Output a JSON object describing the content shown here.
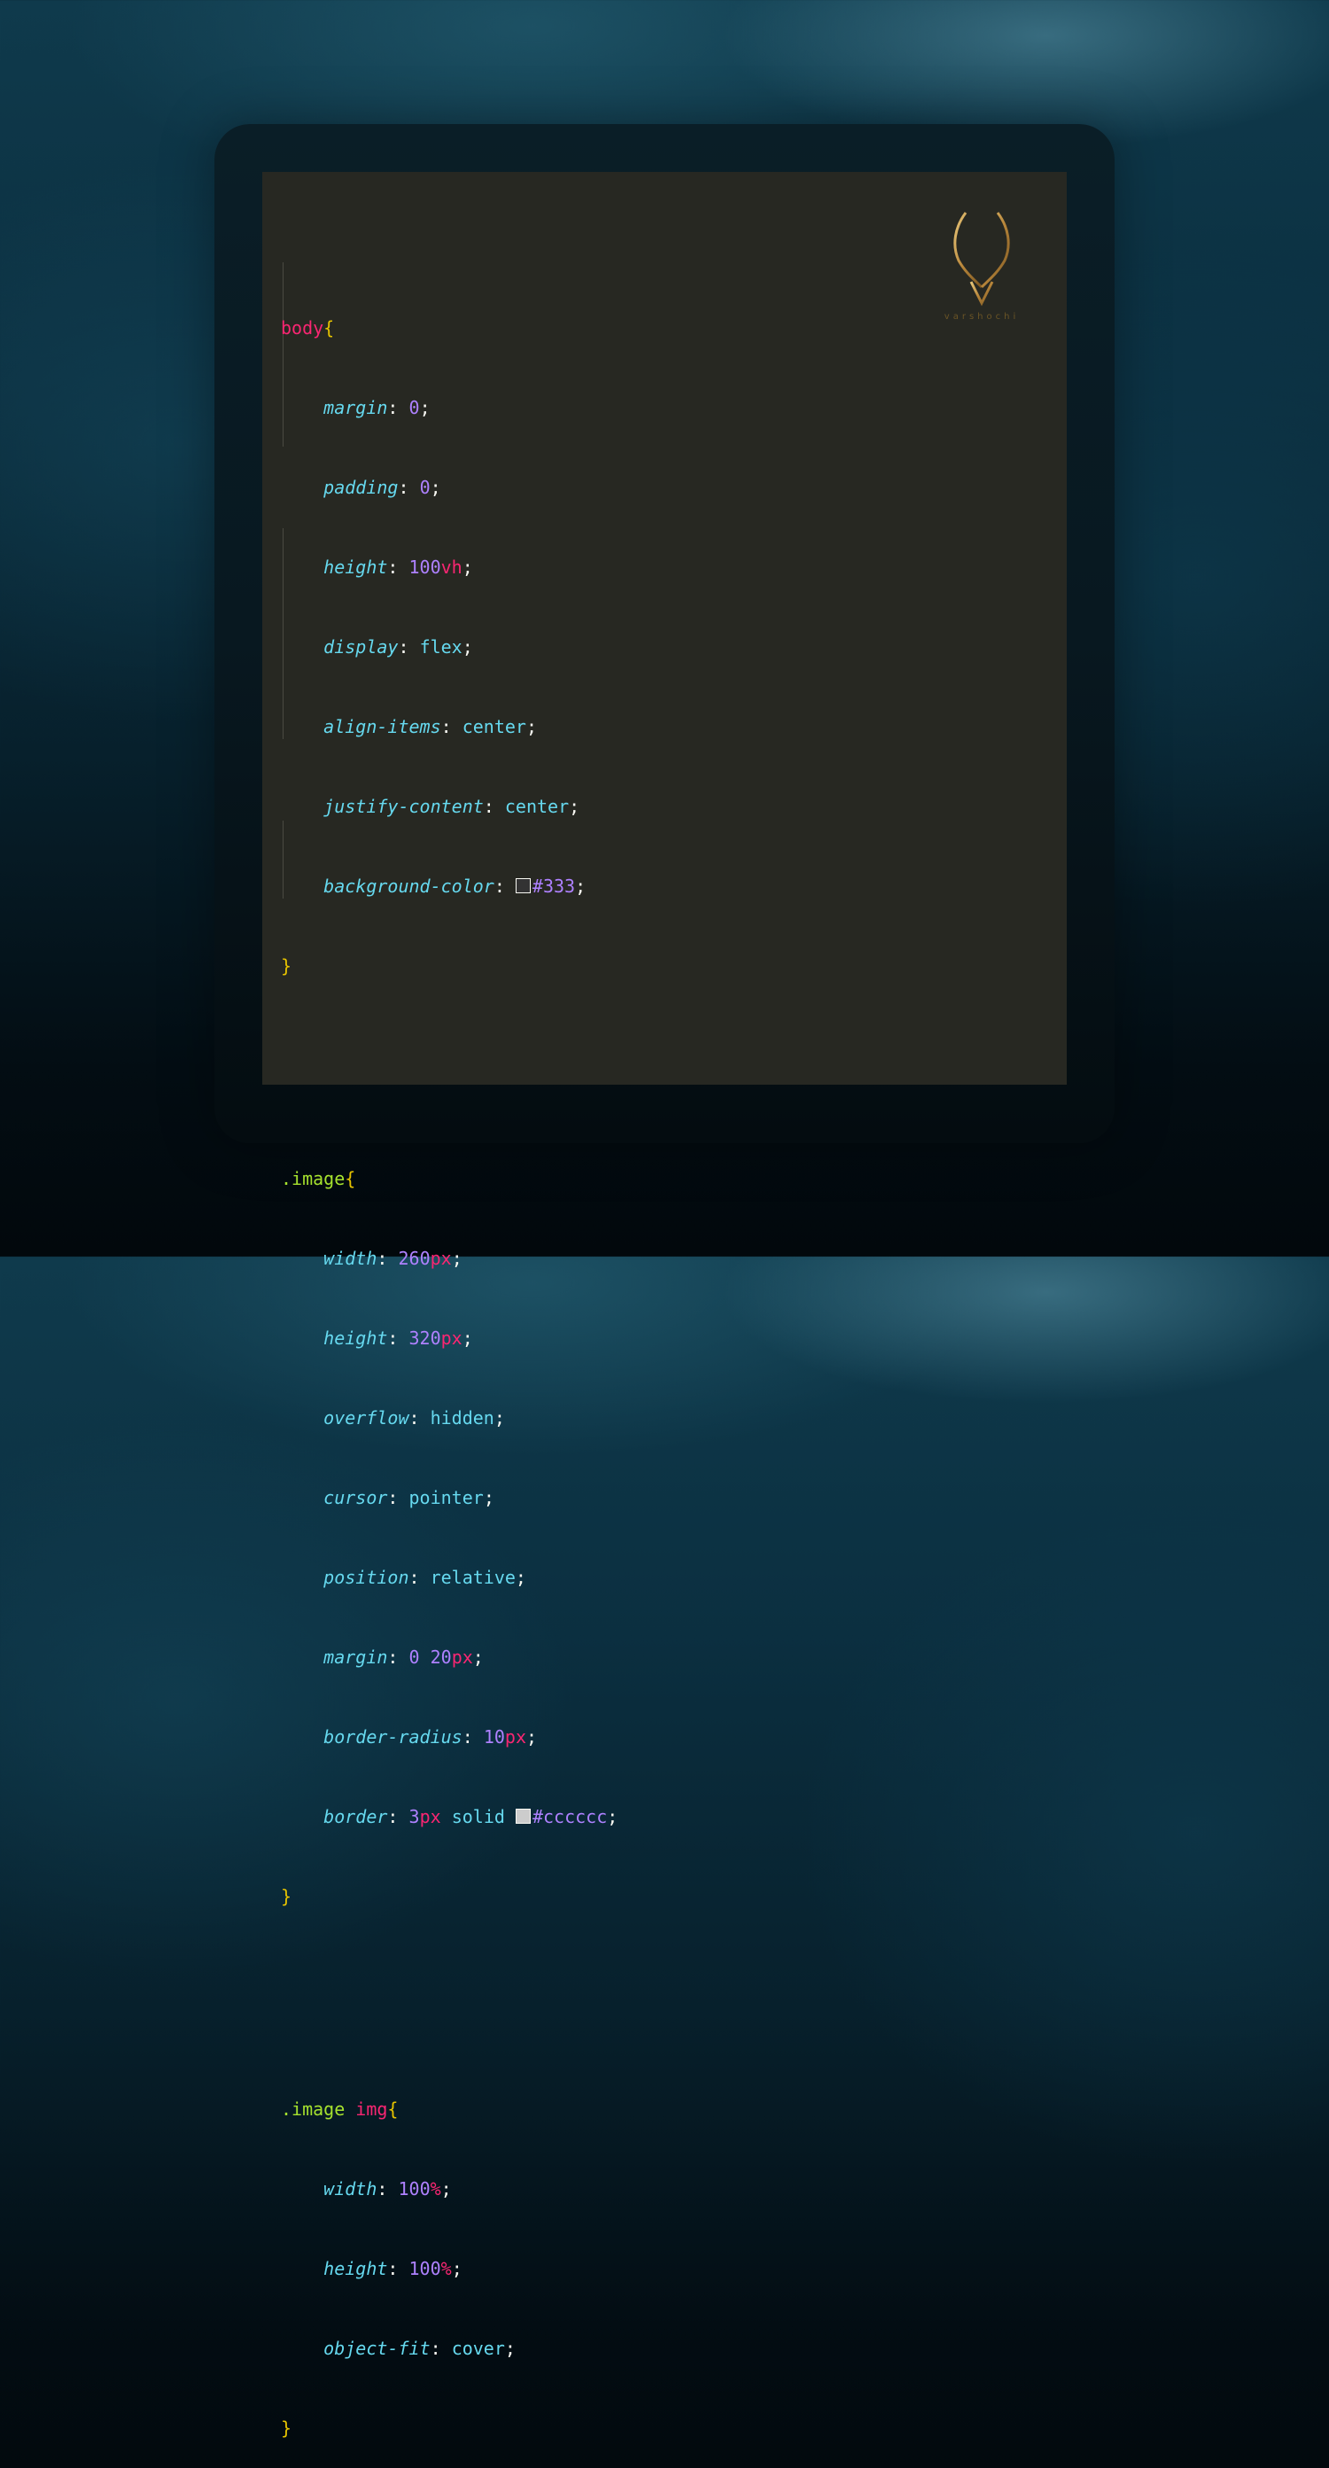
{
  "colors": {
    "background": "#0b2f40",
    "editor_bg": "#272822",
    "selector_tag": "#f92672",
    "selector_class": "#a6e22e",
    "brace": "#e6c300",
    "property": "#66d9ef",
    "number": "#ae81ff",
    "unit": "#f92672",
    "logo_gold": "#c9a35a"
  },
  "logo": {
    "icon": "horns-v-logo-icon",
    "text": "varshochi"
  },
  "code": {
    "body": {
      "selector": "body",
      "open": "{",
      "close": "}",
      "margin": {
        "prop": "margin",
        "value": "0"
      },
      "padding": {
        "prop": "padding",
        "value": "0"
      },
      "height": {
        "prop": "height",
        "num": "100",
        "unit": "vh"
      },
      "display": {
        "prop": "display",
        "value": "flex"
      },
      "align_items": {
        "prop": "align-items",
        "value": "center"
      },
      "justify_content": {
        "prop": "justify-content",
        "value": "center"
      },
      "background_color": {
        "prop": "background-color",
        "swatch": "#333333",
        "value": "#333"
      }
    },
    "image": {
      "selector": ".image",
      "open": "{",
      "close": "}",
      "width": {
        "prop": "width",
        "num": "260",
        "unit": "px"
      },
      "height": {
        "prop": "height",
        "num": "320",
        "unit": "px"
      },
      "overflow": {
        "prop": "overflow",
        "value": "hidden"
      },
      "cursor": {
        "prop": "cursor",
        "value": "pointer"
      },
      "position": {
        "prop": "position",
        "value": "relative"
      },
      "margin": {
        "prop": "margin",
        "num1": "0",
        "num2": "20",
        "unit": "px"
      },
      "border_radius": {
        "prop": "border-radius",
        "num": "10",
        "unit": "px"
      },
      "border": {
        "prop": "border",
        "num": "3",
        "unit": "px",
        "style": "solid",
        "swatch": "#cccccc",
        "value": "#cccccc"
      }
    },
    "image_img": {
      "selector_class": ".image",
      "selector_tag": "img",
      "open": "{",
      "close": "}",
      "width": {
        "prop": "width",
        "num": "100",
        "unit": "%"
      },
      "height": {
        "prop": "height",
        "num": "100",
        "unit": "%"
      },
      "object_fit": {
        "prop": "object-fit",
        "value": "cover"
      }
    }
  }
}
